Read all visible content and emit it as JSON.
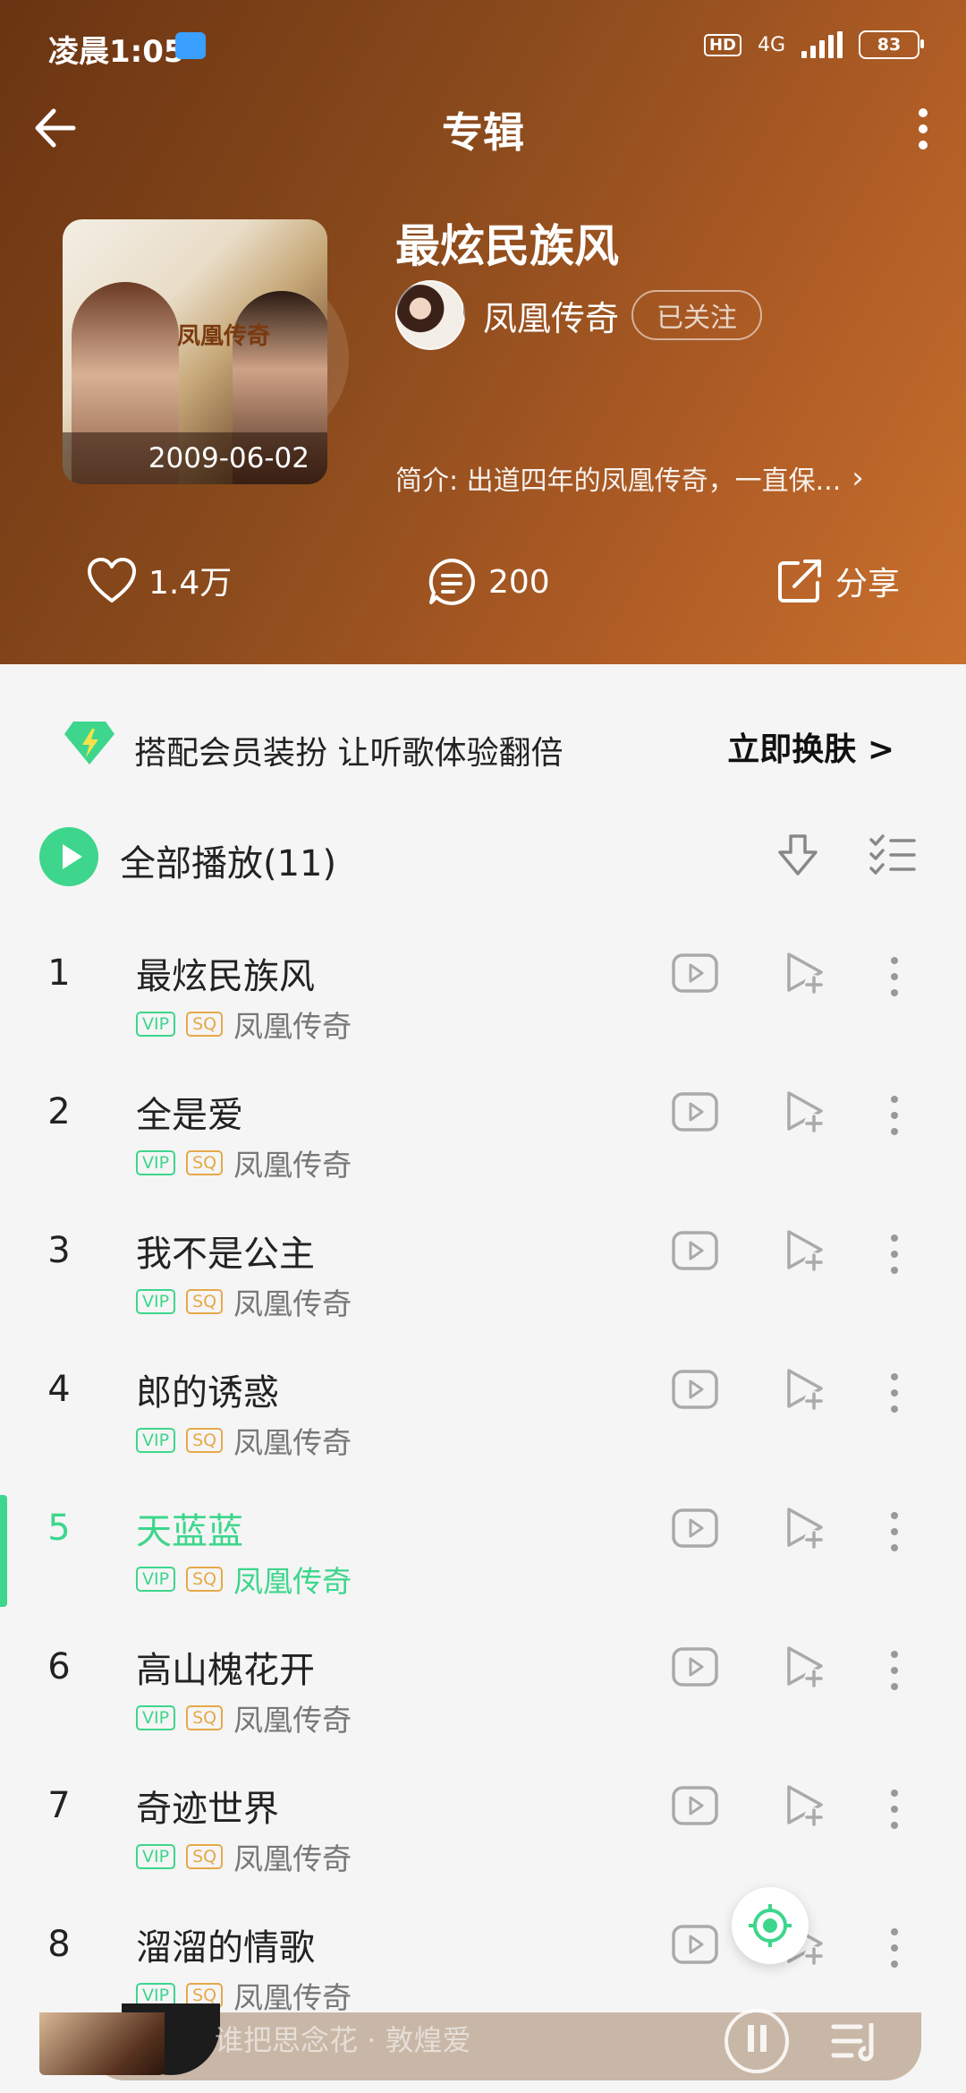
{
  "status_bar": {
    "time": "凌晨1:05",
    "hd": "HD",
    "network": "4G",
    "battery": "83"
  },
  "nav": {
    "title": "专辑"
  },
  "album": {
    "title": "最炫民族风",
    "cover_logo": "凤凰传奇",
    "release_date": "2009-06-02",
    "artist": "凤凰传奇",
    "follow_label": "已关注",
    "intro": "简介: 出道四年的凤凰传奇，一直保..."
  },
  "actions": {
    "likes": "1.4万",
    "comments": "200",
    "share_label": "分享"
  },
  "promo": {
    "text": "搭配会员装扮  让听歌体验翻倍",
    "cta": "立即换肤 >"
  },
  "list_header": {
    "play_all": "全部播放(11)"
  },
  "tags": {
    "vip": "VIP",
    "sq": "SQ"
  },
  "accent_color": "#3dd68c",
  "tracks": [
    {
      "num": "1",
      "title": "最炫民族风",
      "artist": "凤凰传奇"
    },
    {
      "num": "2",
      "title": "全是爱",
      "artist": "凤凰传奇"
    },
    {
      "num": "3",
      "title": "我不是公主",
      "artist": "凤凰传奇"
    },
    {
      "num": "4",
      "title": "郎的诱惑",
      "artist": "凤凰传奇"
    },
    {
      "num": "5",
      "title": "天蓝蓝",
      "artist": "凤凰传奇",
      "playing": true
    },
    {
      "num": "6",
      "title": "高山槐花开",
      "artist": "凤凰传奇"
    },
    {
      "num": "7",
      "title": "奇迹世界",
      "artist": "凤凰传奇"
    },
    {
      "num": "8",
      "title": "溜溜的情歌",
      "artist": "凤凰传奇"
    }
  ],
  "player": {
    "now_playing": "谁把思念花 · 敦煌爱"
  }
}
